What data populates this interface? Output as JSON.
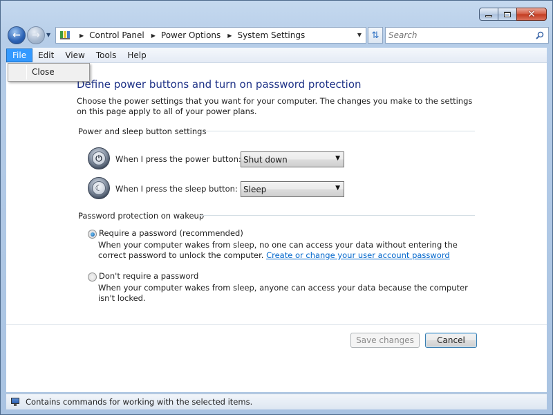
{
  "window": {
    "caption": {
      "minimize": "minimize",
      "maximize": "maximize",
      "close": "close"
    }
  },
  "nav": {
    "breadcrumbs": [
      "Control Panel",
      "Power Options",
      "System Settings"
    ],
    "search_placeholder": "Search"
  },
  "menu": {
    "items": [
      "File",
      "Edit",
      "View",
      "Tools",
      "Help"
    ],
    "active": "File",
    "dropdown": [
      "Close"
    ]
  },
  "content": {
    "heading": "Define power buttons and turn on password protection",
    "intro": "Choose the power settings that you want for your computer. The changes you make to the settings on this page apply to all of your power plans.",
    "buttons_group": {
      "title": "Power and sleep button settings",
      "power_label": "When I press the power button:",
      "power_value": "Shut down",
      "sleep_label": "When I press the sleep button:",
      "sleep_value": "Sleep"
    },
    "password_group": {
      "title": "Password protection on wakeup",
      "require_label": "Require a password (recommended)",
      "require_desc": "When your computer wakes from sleep, no one can access your data without entering the correct password to unlock the computer.",
      "require_link": "Create or change your user account password",
      "require_checked": true,
      "norequire_label": "Don't require a password",
      "norequire_desc": "When your computer wakes from sleep, anyone can access your data because the computer isn't locked."
    },
    "save_label": "Save changes",
    "cancel_label": "Cancel"
  },
  "status": {
    "text": "Contains commands for working with the selected items."
  },
  "colors": {
    "heading": "#1e3287",
    "link": "#0066cc",
    "menu_active": "#3399ff"
  }
}
